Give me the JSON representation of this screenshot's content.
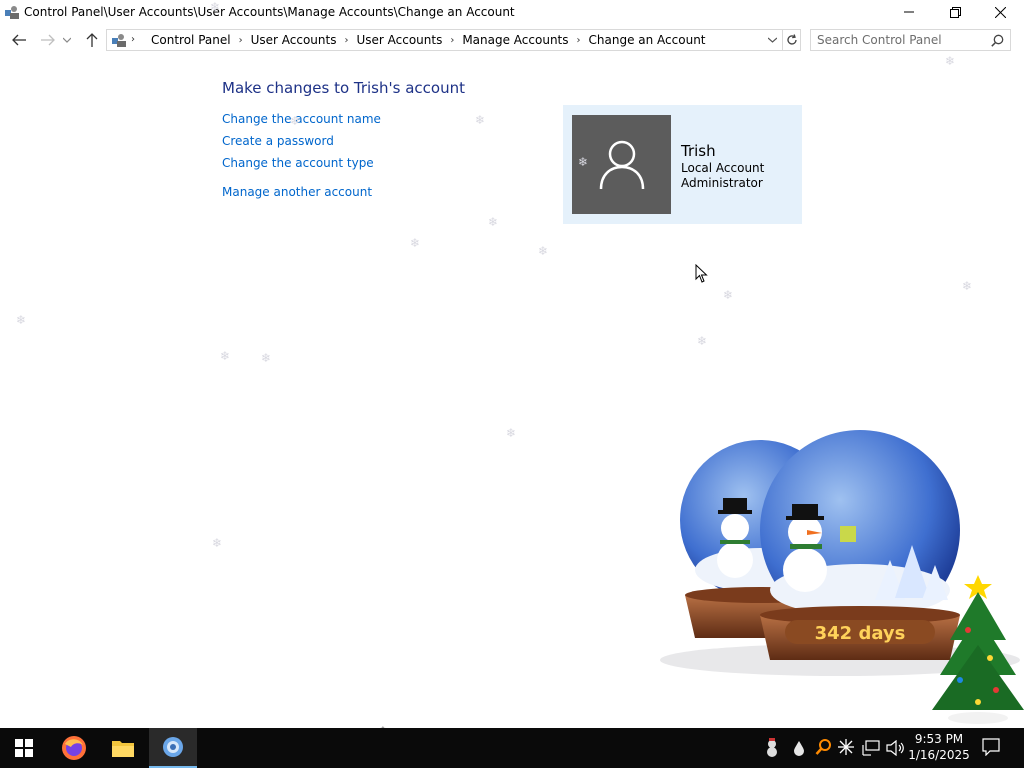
{
  "window": {
    "title": "Control Panel\\User Accounts\\User Accounts\\Manage Accounts\\Change an Account"
  },
  "address_bar": {
    "breadcrumbs": [
      "Control Panel",
      "User Accounts",
      "User Accounts",
      "Manage Accounts",
      "Change an Account"
    ]
  },
  "search": {
    "placeholder": "Search Control Panel"
  },
  "content": {
    "heading": "Make changes to Trish's account",
    "tasks": [
      "Change the account name",
      "Create a password",
      "Change the account type",
      "Manage another account"
    ]
  },
  "account": {
    "name": "Trish",
    "type": "Local Account",
    "role": "Administrator"
  },
  "desktop": {
    "globe_counter": "342 days"
  },
  "taskbar": {
    "time": "9:53 PM",
    "date": "1/16/2025",
    "pinned_icons": [
      "start-icon",
      "firefox-icon",
      "file-explorer-icon",
      "control-panel-icon"
    ],
    "tray_icons": [
      "snowman-icon",
      "water-drop-icon",
      "search-tray-icon",
      "sparkle-icon",
      "network-icon",
      "volume-icon",
      "notifications-icon"
    ]
  },
  "colors": {
    "heading": "#1e3287",
    "link": "#0066cc",
    "card_bg": "#e5f1fb",
    "avatar_bg": "#5c5c5c",
    "taskbar": "#0a0a0a"
  }
}
